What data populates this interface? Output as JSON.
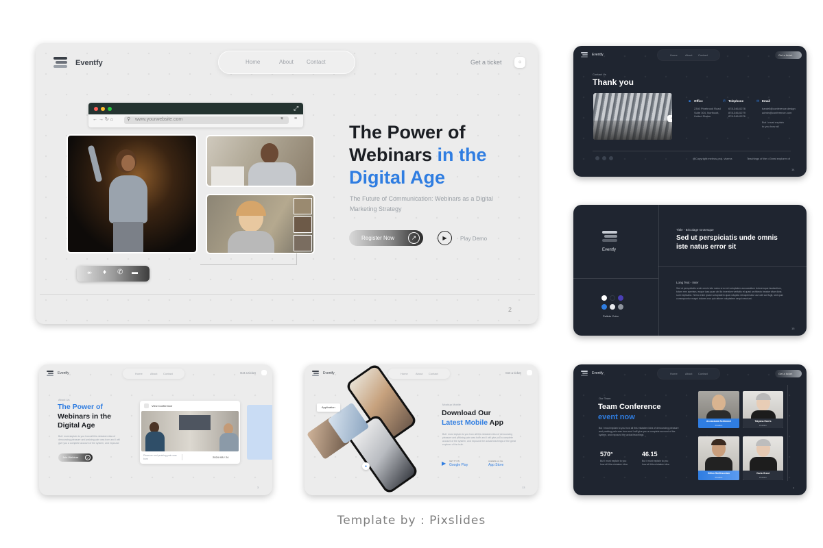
{
  "colors": {
    "accent": "#2f7de1",
    "dark_bg": "#1f2530",
    "light_bg": "#ececec"
  },
  "brand": "Eventfy",
  "nav": {
    "home": "Home",
    "about": "About",
    "contact": "Contact",
    "ticket": "Get a ticket"
  },
  "main": {
    "url": "www.yourwebsite.com",
    "title_line1": "The Power of",
    "title_line2_a": "Webinars ",
    "title_line2_b": "in the",
    "title_line3": "Digital Age",
    "subtitle": "The Future of Communication: Webinars as a Digital Marketing Strategy",
    "register": "Register Now",
    "play": "Play Demo",
    "page": "2"
  },
  "contact": {
    "tag": "Contact Us",
    "title": "Thank you",
    "office_label": "Office",
    "office_text": "2340 Pinebrook Road Suite 304, Northcott, United States",
    "phone_label": "Telephone",
    "phone_text": "678-346-0278 878-346-0279 876-346-0976",
    "email_label": "Email",
    "email_text": "bardell@conference.design admin@conference.com",
    "email_note": "But I must explain to you how all",
    "copyright": "@Copyright meleus-proj. viverra",
    "terms": "Teachings of the • Great explorer of",
    "page": "14"
  },
  "brandslide": {
    "font_tag": "Tittle - Bricolage Grotesque",
    "heading": "Sed ut perspiciatis unde omnis iste natus error sit",
    "long_tag": "Long Text - Inter",
    "body": "Sed ut perspiciatis unde omnis iste natus error sit voluptatem accusantium doloremque laudantium, totam rem aperiam, eaque ipsa quae ab illo inventore veritatis et quasi architecto beatae vitae dicta sunt explicabo. Nemo enim ipsam voluptatem quia voluptas sit aspernatur aut odit aut fugit, sed quia consequuntur magni dolores eos qui ratione voluptatem sequi nesciunt.",
    "palette": "Pallete Color",
    "page": "15"
  },
  "small1": {
    "tag": "About Us",
    "title_a": "The Power of",
    "title_b": "Webinars in the",
    "title_c": "Digital Age",
    "body": "But I must explain to you how all this mistaken idea of denouncing pleasure and praising pain was born and I will give you a complete account of the system, and expound",
    "btn": "Join Webinar",
    "card_head": "View Conference",
    "card_text": "Pleasure and praising pain was born",
    "card_date": "2024 /08 / 24",
    "page": "3"
  },
  "small2": {
    "badge": "Application",
    "tag": "Mockup Mobile",
    "title_a": "Download Our",
    "title_b": "Latest Mobile",
    "title_c": " App",
    "body": "But I must explain to you how all this mistaken idea of denouncing pleasure and praising pain was born and I will give you a complete account of the system, and expound the actual teachings of the great explorer of the truth",
    "gp_small": "GET IT ON",
    "gp": "Google Play",
    "as_small": "Available on the",
    "as": "App Store",
    "page": "13"
  },
  "team": {
    "tag": "Our Team",
    "title_a": "Team Conference",
    "title_b": "event now",
    "body": "But I must explain to you how all this mistaken idea of denouncing pleasure and praising pain was born and I will give you a complete account of the system, and expound the actual teachings",
    "stat1": "570°",
    "stat1_text": "But I must explain to you how all this mistaken idea",
    "stat2": "46.15",
    "stat2_text": "But I must explain to you how all this mistaken idea",
    "members": [
      {
        "name": "Annastasia Schimmel",
        "role": "Position"
      },
      {
        "name": "Tatyana Harris",
        "role": "Position"
      },
      {
        "name": "Dillon Smithsonian",
        "role": "Position"
      },
      {
        "name": "Carla Grant",
        "role": "Position"
      }
    ],
    "page": "7"
  },
  "footer": "Template by : Pixslides",
  "icons": [
    "menu-dots-icon",
    "arrow-up-right-icon",
    "play-icon",
    "microphone-icon",
    "phone-icon",
    "chat-icon",
    "expand-icon",
    "google-play-icon",
    "apple-icon",
    "location-icon",
    "mail-icon"
  ]
}
